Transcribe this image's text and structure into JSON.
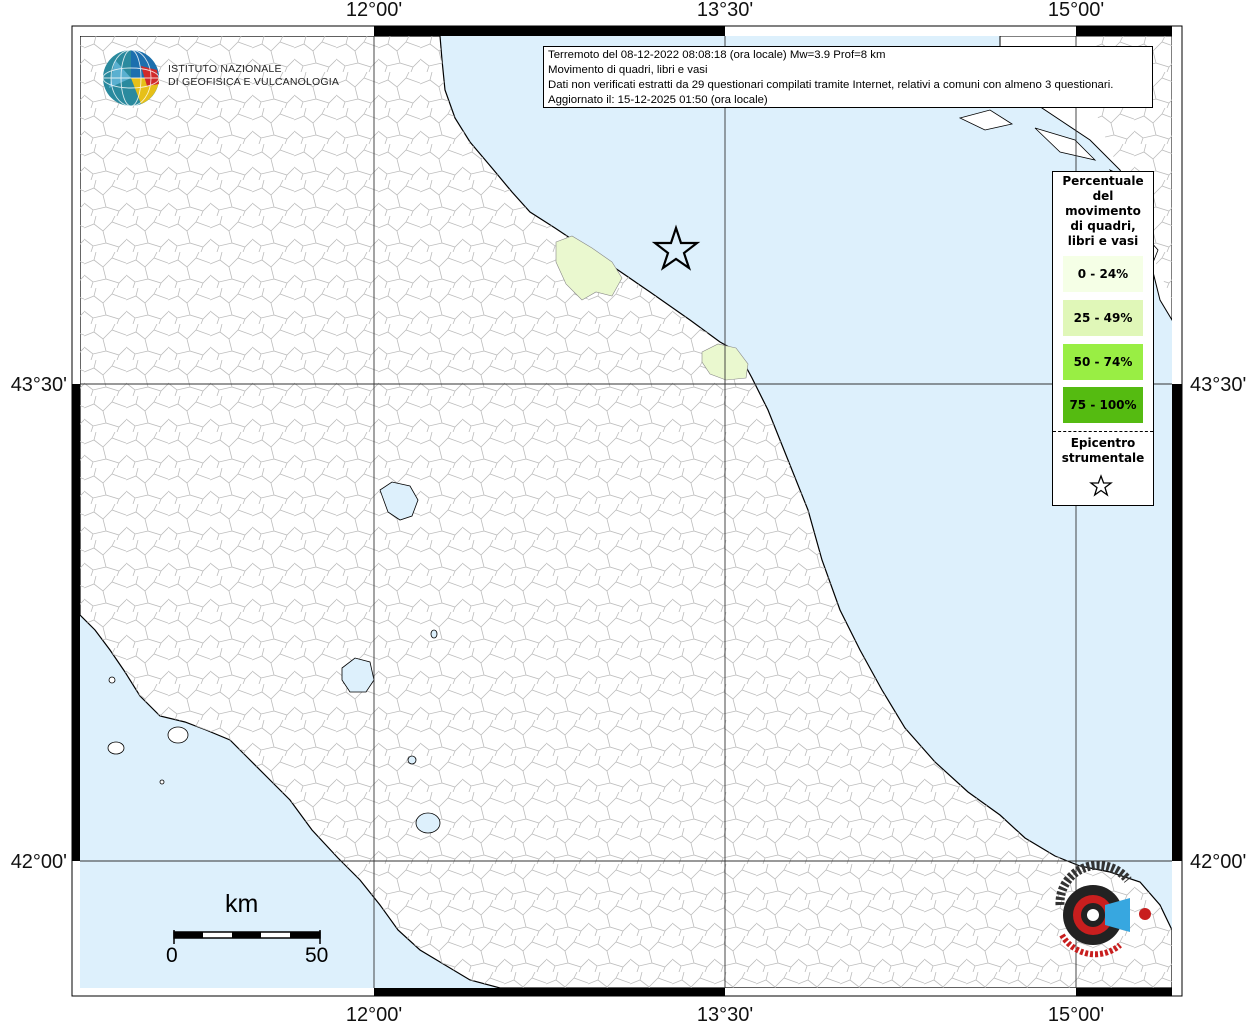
{
  "info": {
    "line1": "Terremoto del 08-12-2022 08:08:18 (ora locale) Mw=3.9 Prof=8 km",
    "line2": "Movimento di quadri, libri e vasi",
    "line3": "Dati non verificati estratti da 29 questionari compilati tramite Internet, relativi a comuni con almeno 3 questionari.",
    "line4": "Aggiornato il: 15-12-2025 01:50 (ora locale)"
  },
  "axes": {
    "top": [
      "12°00'",
      "13°30'",
      "15°00'"
    ],
    "bottom": [
      "12°00'",
      "13°30'",
      "15°00'"
    ],
    "left": [
      "43°30'",
      "42°00'"
    ],
    "right": [
      "43°30'",
      "42°00'"
    ]
  },
  "legend": {
    "title": [
      "Percentuale",
      "del",
      "movimento",
      "di quadri,",
      "libri e vasi"
    ],
    "classes": [
      {
        "label": "0 - 24%",
        "color": "#f5ffe6"
      },
      {
        "label": "25 - 49%",
        "color": "#e0f7b8"
      },
      {
        "label": "50 - 74%",
        "color": "#99ee44"
      },
      {
        "label": "75 - 100%",
        "color": "#55bb11"
      }
    ],
    "epicenter_label": [
      "Epicentro",
      "strumentale"
    ]
  },
  "institute": {
    "line1": "ISTITUTO NAZIONALE",
    "line2": "DI GEOFISICA E VULCANOLOGIA"
  },
  "scale": {
    "unit": "km",
    "min": "0",
    "max": "50"
  },
  "colors": {
    "sea": "#ddf0fc",
    "land": "#ffffff",
    "affected": "#eaf8cf",
    "grid": "#333333"
  },
  "icons": {
    "epicenter": "star-outline-icon"
  }
}
